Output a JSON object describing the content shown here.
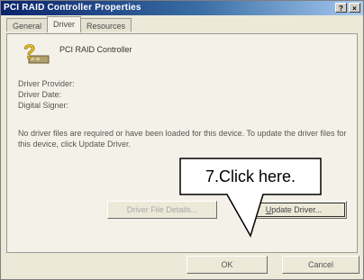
{
  "window": {
    "title": "PCI RAID Controller Properties",
    "help_label": "?",
    "close_label": "×"
  },
  "tabs": [
    {
      "label": "General"
    },
    {
      "label": "Driver"
    },
    {
      "label": "Resources"
    }
  ],
  "device": {
    "icon": "question-mark-device-icon",
    "name": "PCI RAID Controller"
  },
  "fields": {
    "provider_label": "Driver Provider:",
    "date_label": "Driver Date:",
    "signer_label": "Digital Signer:"
  },
  "info_text": "No driver files are required or have been loaded for this device. To update the driver files for this device, click Update Driver.",
  "buttons": {
    "details": "Driver File Details...",
    "update_underlined": "U",
    "update_rest": "pdate Driver...",
    "ok": "OK",
    "cancel": "Cancel"
  },
  "callout": {
    "text": "7.Click here."
  },
  "colors": {
    "titlebar_start": "#0a246a",
    "window_bg": "#ece9d8"
  }
}
